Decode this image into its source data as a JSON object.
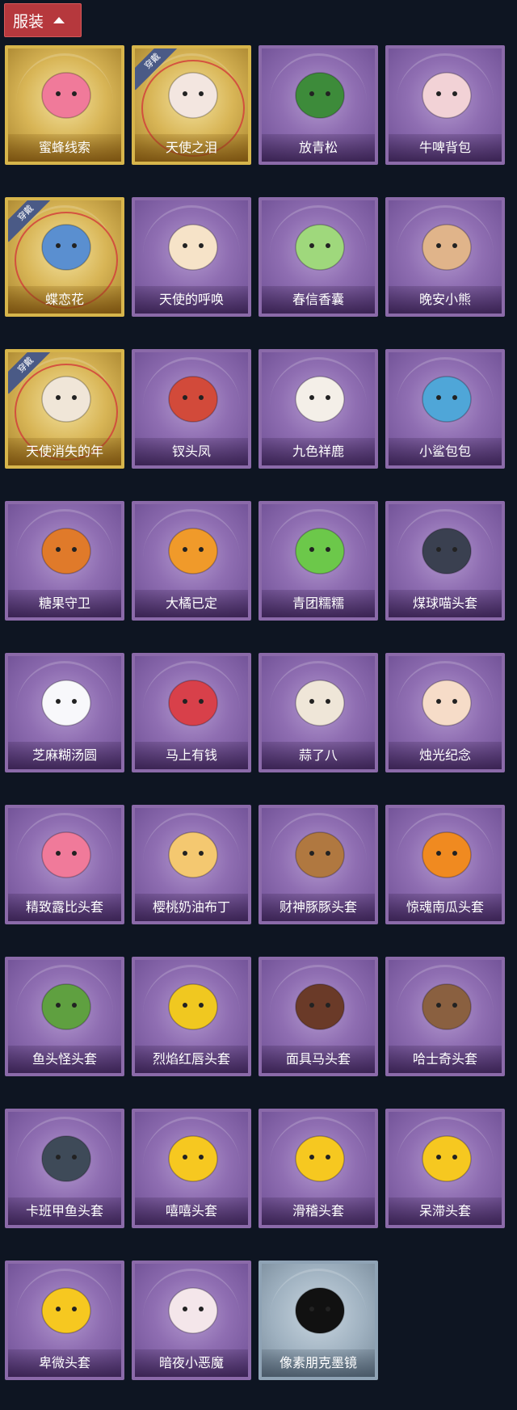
{
  "header": {
    "title": "服装"
  },
  "items": [
    {
      "label": "蜜蜂线索",
      "tier": "gold",
      "equipped": false,
      "icon": "bee-plush-icon",
      "color": "#f07a9a"
    },
    {
      "label": "天使之泪",
      "tier": "gold",
      "equipped": true,
      "icon": "angel-wings-icon",
      "color": "#f3e6e0"
    },
    {
      "label": "放青松",
      "tier": "purple",
      "equipped": false,
      "icon": "potted-pine-icon",
      "color": "#3d8b3a"
    },
    {
      "label": "牛啤背包",
      "tier": "purple",
      "equipped": false,
      "icon": "cow-beer-mug-icon",
      "color": "#f2d2d6"
    },
    {
      "label": "蝶恋花",
      "tier": "gold",
      "equipped": true,
      "icon": "butterfly-wreath-icon",
      "color": "#5a8fd0"
    },
    {
      "label": "天使的呼唤",
      "tier": "purple",
      "equipped": false,
      "icon": "angel-doll-icon",
      "color": "#f6e3c8"
    },
    {
      "label": "春信香囊",
      "tier": "purple",
      "equipped": false,
      "icon": "sachet-icon",
      "color": "#9fd87c"
    },
    {
      "label": "晚安小熊",
      "tier": "purple",
      "equipped": false,
      "icon": "bear-charm-icon",
      "color": "#e0b48a"
    },
    {
      "label": "天使消失的年",
      "tier": "gold",
      "equipped": true,
      "icon": "veiled-girl-icon",
      "color": "#f0e6d8"
    },
    {
      "label": "钗头凤",
      "tier": "purple",
      "equipped": false,
      "icon": "phoenix-crown-icon",
      "color": "#d24a3a"
    },
    {
      "label": "九色祥鹿",
      "tier": "purple",
      "equipped": false,
      "icon": "deer-charm-icon",
      "color": "#f4efe8"
    },
    {
      "label": "小鲨包包",
      "tier": "purple",
      "equipped": false,
      "icon": "shark-bag-icon",
      "color": "#4fa6d8"
    },
    {
      "label": "糖果守卫",
      "tier": "purple",
      "equipped": false,
      "icon": "pumpkin-scarecrow-icon",
      "color": "#e07a2a"
    },
    {
      "label": "大橘已定",
      "tier": "purple",
      "equipped": false,
      "icon": "orange-slice-icon",
      "color": "#f09a2a"
    },
    {
      "label": "青团糯糯",
      "tier": "purple",
      "equipped": false,
      "icon": "green-rice-ball-icon",
      "color": "#6cc84a"
    },
    {
      "label": "煤球喵头套",
      "tier": "purple",
      "equipped": false,
      "icon": "black-cat-head-icon",
      "color": "#3a4050"
    },
    {
      "label": "芝麻糊汤圆",
      "tier": "purple",
      "equipped": false,
      "icon": "dumpling-head-icon",
      "color": "#f8f8fb"
    },
    {
      "label": "马上有钱",
      "tier": "purple",
      "equipped": false,
      "icon": "horse-head-icon",
      "color": "#d8404a"
    },
    {
      "label": "蒜了八",
      "tier": "purple",
      "equipped": false,
      "icon": "garlic-head-icon",
      "color": "#efe6d8"
    },
    {
      "label": "烛光纪念",
      "tier": "purple",
      "equipped": false,
      "icon": "candle-head-icon",
      "color": "#f6dcc8"
    },
    {
      "label": "精致露比头套",
      "tier": "purple",
      "equipped": false,
      "icon": "loopy-head-icon",
      "color": "#f07a9a"
    },
    {
      "label": "樱桃奶油布丁",
      "tier": "purple",
      "equipped": false,
      "icon": "pudding-head-icon",
      "color": "#f4c870"
    },
    {
      "label": "财神豚豚头套",
      "tier": "purple",
      "equipped": false,
      "icon": "capybara-head-icon",
      "color": "#b07840"
    },
    {
      "label": "惊魂南瓜头套",
      "tier": "purple",
      "equipped": false,
      "icon": "jack-o-lantern-icon",
      "color": "#f08a20"
    },
    {
      "label": "鱼头怪头套",
      "tier": "purple",
      "equipped": false,
      "icon": "fish-head-icon",
      "color": "#5fa040"
    },
    {
      "label": "烈焰红唇头套",
      "tier": "purple",
      "equipped": false,
      "icon": "yellow-mouse-head-icon",
      "color": "#f0c820"
    },
    {
      "label": "面具马头套",
      "tier": "purple",
      "equipped": false,
      "icon": "horse-mask-icon",
      "color": "#6a3a28"
    },
    {
      "label": "哈士奇头套",
      "tier": "purple",
      "equipped": false,
      "icon": "husky-head-icon",
      "color": "#8a6040"
    },
    {
      "label": "卡班甲鱼头套",
      "tier": "purple",
      "equipped": false,
      "icon": "catfish-head-icon",
      "color": "#3e4a58"
    },
    {
      "label": "嘻嘻头套",
      "tier": "purple",
      "equipped": false,
      "icon": "grin-emoji-icon",
      "color": "#f6c820"
    },
    {
      "label": "滑稽头套",
      "tier": "purple",
      "equipped": false,
      "icon": "smirk-emoji-icon",
      "color": "#f6c820"
    },
    {
      "label": "呆滞头套",
      "tier": "purple",
      "equipped": false,
      "icon": "stare-emoji-icon",
      "color": "#f6c820"
    },
    {
      "label": "卑微头套",
      "tier": "purple",
      "equipped": false,
      "icon": "humble-emoji-icon",
      "color": "#f6c820"
    },
    {
      "label": "暗夜小恶魔",
      "tier": "purple",
      "equipped": false,
      "icon": "devil-head-icon",
      "color": "#f4e6ea"
    },
    {
      "label": "像素朋克墨镜",
      "tier": "silver",
      "equipped": false,
      "icon": "pixel-sunglasses-icon",
      "color": "#111111"
    }
  ],
  "badge_text": "穿戴"
}
